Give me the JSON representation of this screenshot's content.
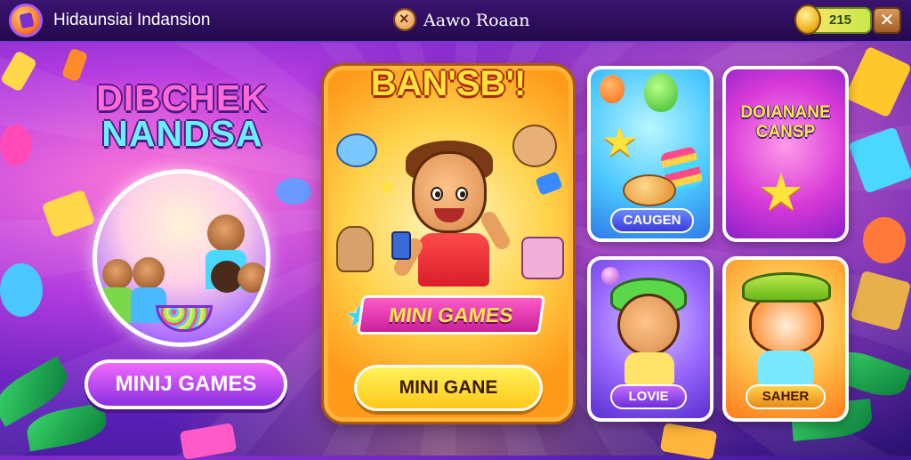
{
  "header": {
    "app_title": "Hidaunsiai Indansion",
    "center_title": "Aawo Roaan",
    "coins": "215",
    "close_label": "✕"
  },
  "left_panel": {
    "title_line1": "DIBCHEK",
    "title_line2": "NANDSA",
    "button_label": "MINIJ GAMES"
  },
  "center_card": {
    "title": "BAN'SB'!",
    "ribbon_label": "MINI GAMES",
    "button_label": "MINI GANE"
  },
  "cards": [
    {
      "label": "CAUGEN"
    },
    {
      "title_line1": "DOIANANE",
      "title_line2": "CANSP"
    },
    {
      "label": "LOVIE"
    },
    {
      "label": "SAHER"
    }
  ],
  "colors": {
    "background": "#b23be0",
    "topbar": "#2e0f5e",
    "center_card": "#ffd24a",
    "primary_button": "#c84af0",
    "gold_button": "#ffd82a"
  },
  "icons": {
    "app_logo": "game-logo-icon",
    "center_badge": "badge-icon",
    "coin": "coin-icon",
    "close": "close-icon"
  }
}
